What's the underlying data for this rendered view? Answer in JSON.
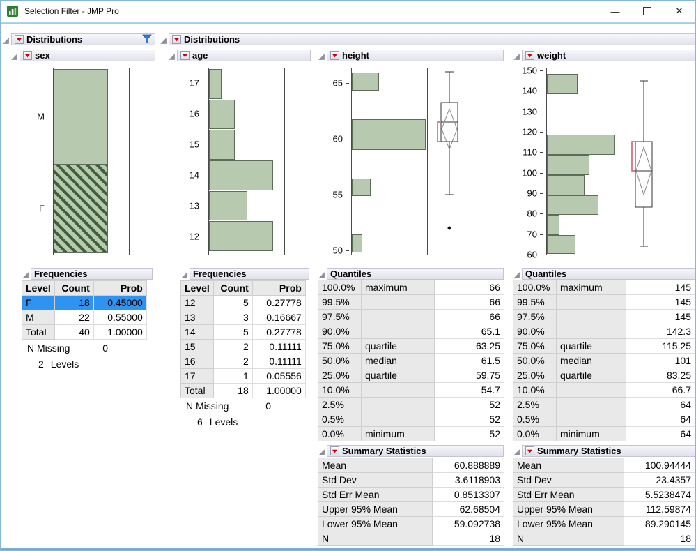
{
  "window": {
    "title": "Selection Filter - JMP Pro",
    "minimize_glyph": "—",
    "close_glyph": "✕"
  },
  "filter_panel": {
    "title": "Distributions",
    "sex": {
      "title": "sex",
      "axis": [
        {
          "label": "M",
          "pos": 26.0
        },
        {
          "label": "F",
          "pos": 75.0
        }
      ],
      "bars": [
        {
          "t": 0.4,
          "h": 51.3,
          "w": 72
        },
        {
          "t": 51.7,
          "h": 47.6,
          "w": 72,
          "hatch": true
        }
      ]
    },
    "frequencies": {
      "title": "Frequencies",
      "columns": [
        "Level",
        "Count",
        "Prob"
      ],
      "rows": [
        [
          "F",
          "18",
          "0.45000"
        ],
        [
          "M",
          "22",
          "0.55000"
        ],
        [
          "Total",
          "40",
          "1.00000"
        ]
      ],
      "n_missing_label": "N Missing",
      "n_missing_value": "0",
      "levels_count": "2",
      "levels_label": "Levels"
    }
  },
  "dist_panel": {
    "title": "Distributions",
    "age": {
      "title": "age",
      "axis": [
        {
          "label": "17",
          "pos": 8.2
        },
        {
          "label": "16",
          "pos": 24.5
        },
        {
          "label": "15",
          "pos": 40.9
        },
        {
          "label": "14",
          "pos": 57.2
        },
        {
          "label": "13",
          "pos": 73.6
        },
        {
          "label": "12",
          "pos": 90.0
        }
      ],
      "bars": [
        {
          "t": 0.4,
          "h": 16.0,
          "w": 17
        },
        {
          "t": 16.7,
          "h": 16.0,
          "w": 34
        },
        {
          "t": 33.1,
          "h": 16.0,
          "w": 34
        },
        {
          "t": 49.4,
          "h": 16.0,
          "w": 85
        },
        {
          "t": 65.8,
          "h": 16.0,
          "w": 51
        },
        {
          "t": 82.2,
          "h": 16.0,
          "w": 85
        }
      ],
      "frequencies": {
        "title": "Frequencies",
        "columns": [
          "Level",
          "Count",
          "Prob"
        ],
        "rows": [
          [
            "12",
            "5",
            "0.27778"
          ],
          [
            "13",
            "3",
            "0.16667"
          ],
          [
            "14",
            "5",
            "0.27778"
          ],
          [
            "15",
            "2",
            "0.11111"
          ],
          [
            "16",
            "2",
            "0.11111"
          ],
          [
            "17",
            "1",
            "0.05556"
          ],
          [
            "Total",
            "18",
            "1.00000"
          ]
        ],
        "n_missing_label": "N Missing",
        "n_missing_value": "0",
        "levels_count": "6",
        "levels_label": "Levels"
      }
    },
    "height": {
      "title": "height",
      "axis": [
        {
          "label": "65",
          "pos": 8.2
        },
        {
          "label": "60",
          "pos": 37.9
        },
        {
          "label": "55",
          "pos": 67.7
        },
        {
          "label": "50",
          "pos": 97.4
        }
      ],
      "bars": [
        {
          "t": 2.2,
          "h": 9.7,
          "w": 36
        },
        {
          "t": 27.5,
          "h": 16.4,
          "w": 98
        },
        {
          "t": 59.0,
          "h": 9.7,
          "w": 25
        },
        {
          "t": 89.2,
          "h": 9.8,
          "w": 14
        }
      ],
      "quantiles": {
        "title": "Quantiles",
        "rows": [
          [
            "100.0%",
            "maximum",
            "66"
          ],
          [
            "99.5%",
            "",
            "66"
          ],
          [
            "97.5%",
            "",
            "66"
          ],
          [
            "90.0%",
            "",
            "65.1"
          ],
          [
            "75.0%",
            "quartile",
            "63.25"
          ],
          [
            "50.0%",
            "median",
            "61.5"
          ],
          [
            "25.0%",
            "quartile",
            "59.75"
          ],
          [
            "10.0%",
            "",
            "54.7"
          ],
          [
            "2.5%",
            "",
            "52"
          ],
          [
            "0.5%",
            "",
            "52"
          ],
          [
            "0.0%",
            "minimum",
            "52"
          ]
        ]
      },
      "summary": {
        "title": "Summary Statistics",
        "rows": [
          [
            "Mean",
            "60.888889"
          ],
          [
            "Std Dev",
            "3.6118903"
          ],
          [
            "Std Err Mean",
            "0.8513307"
          ],
          [
            "Upper 95% Mean",
            "62.68504"
          ],
          [
            "Lower 95% Mean",
            "59.092738"
          ],
          [
            "N",
            "18"
          ]
        ]
      }
    },
    "weight": {
      "title": "weight",
      "axis": [
        {
          "label": "150",
          "pos": 1.5
        },
        {
          "label": "140",
          "pos": 12.4
        },
        {
          "label": "130",
          "pos": 23.3
        },
        {
          "label": "120",
          "pos": 34.2
        },
        {
          "label": "110",
          "pos": 45.1
        },
        {
          "label": "100",
          "pos": 56.0
        },
        {
          "label": "90",
          "pos": 66.9
        },
        {
          "label": "80",
          "pos": 77.8
        },
        {
          "label": "70",
          "pos": 88.7
        },
        {
          "label": "60",
          "pos": 99.6
        }
      ],
      "bars": [
        {
          "t": 3.0,
          "h": 10.8,
          "w": 40
        },
        {
          "t": 35.7,
          "h": 10.8,
          "w": 89
        },
        {
          "t": 46.5,
          "h": 10.8,
          "w": 55
        },
        {
          "t": 57.2,
          "h": 10.8,
          "w": 49
        },
        {
          "t": 68.0,
          "h": 10.8,
          "w": 67
        },
        {
          "t": 78.8,
          "h": 10.8,
          "w": 16
        },
        {
          "t": 89.6,
          "h": 10.0,
          "w": 37
        }
      ],
      "quantiles": {
        "title": "Quantiles",
        "rows": [
          [
            "100.0%",
            "maximum",
            "145"
          ],
          [
            "99.5%",
            "",
            "145"
          ],
          [
            "97.5%",
            "",
            "145"
          ],
          [
            "90.0%",
            "",
            "142.3"
          ],
          [
            "75.0%",
            "quartile",
            "115.25"
          ],
          [
            "50.0%",
            "median",
            "101"
          ],
          [
            "25.0%",
            "quartile",
            "83.25"
          ],
          [
            "10.0%",
            "",
            "66.7"
          ],
          [
            "2.5%",
            "",
            "64"
          ],
          [
            "0.5%",
            "",
            "64"
          ],
          [
            "0.0%",
            "minimum",
            "64"
          ]
        ]
      },
      "summary": {
        "title": "Summary Statistics",
        "rows": [
          [
            "Mean",
            "100.94444"
          ],
          [
            "Std Dev",
            "23.4357"
          ],
          [
            "Std Err Mean",
            "5.5238474"
          ],
          [
            "Upper 95% Mean",
            "112.59874"
          ],
          [
            "Lower 95% Mean",
            "89.290145"
          ],
          [
            "N",
            "18"
          ]
        ]
      }
    }
  },
  "chart_data": [
    {
      "type": "bar",
      "orientation": "horizontal",
      "title": "sex",
      "categories": [
        "M",
        "F"
      ],
      "values": [
        22,
        18
      ],
      "selected_category": "F"
    },
    {
      "type": "bar",
      "orientation": "horizontal",
      "title": "age",
      "categories": [
        17,
        16,
        15,
        14,
        13,
        12
      ],
      "values": [
        1,
        2,
        2,
        5,
        3,
        5
      ]
    },
    {
      "type": "histogram",
      "title": "height",
      "axis_range": [
        50,
        67
      ],
      "box_plot": {
        "min": 52,
        "q1": 59.75,
        "median": 61.5,
        "q3": 63.25,
        "max": 66,
        "mean": 60.888889,
        "ci_low": 59.092738,
        "ci_high": 62.68504,
        "outliers": [
          52
        ]
      }
    },
    {
      "type": "histogram",
      "title": "weight",
      "axis_range": [
        60,
        151
      ],
      "box_plot": {
        "min": 64,
        "q1": 83.25,
        "median": 101,
        "q3": 115.25,
        "max": 145,
        "mean": 100.94444,
        "ci_low": 89.290145,
        "ci_high": 112.59874,
        "outliers": []
      }
    }
  ],
  "colors": {
    "bar_fill": "#b7c9ae",
    "bar_hatch": "#40603a",
    "selection_blue": "#2f93f2",
    "red_triangle": "#cc0000",
    "bracket_red": "#d4556a"
  }
}
